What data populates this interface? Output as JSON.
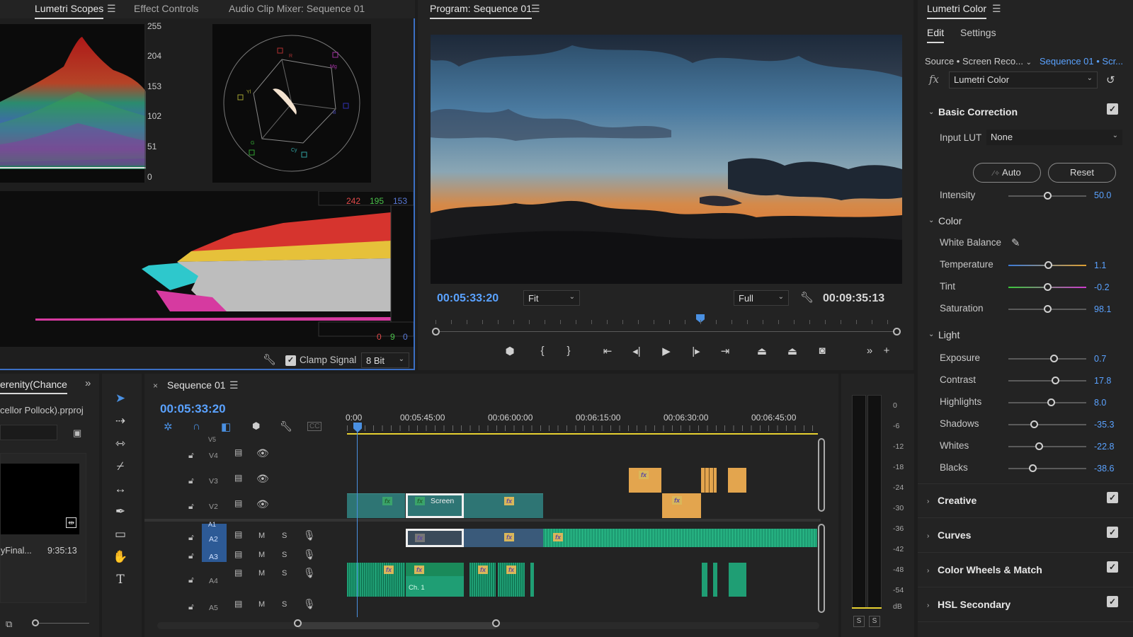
{
  "scopes_panel": {
    "tabs": [
      {
        "label": "Lumetri Scopes",
        "active": true
      },
      {
        "label": "Effect Controls",
        "active": false
      },
      {
        "label": "Audio Clip Mixer: Sequence 01",
        "active": false
      }
    ],
    "parade_scale": [
      "255",
      "204",
      "153",
      "102",
      "51",
      "0"
    ],
    "histogram_values": {
      "r": "242",
      "g": "195",
      "b": "153"
    },
    "histogram_values_low": {
      "r": "0",
      "g": "9",
      "b": "0"
    },
    "clamp_signal_label": "Clamp Signal",
    "clamp_signal_checked": true,
    "bit_depth": "8 Bit",
    "vectorscope_targets": [
      "R",
      "Mg",
      "B",
      "Cy",
      "G",
      "Yl"
    ]
  },
  "program_monitor": {
    "title": "Program: Sequence 01",
    "current_time": "00:05:33:20",
    "fit_option": "Fit",
    "resolution": "Full",
    "duration": "00:09:35:13",
    "playhead_fraction": 0.56
  },
  "lumetri_color": {
    "title": "Lumetri Color",
    "tabs": [
      {
        "label": "Edit",
        "active": true
      },
      {
        "label": "Settings",
        "active": false
      }
    ],
    "source_label": "Source • Screen Reco...",
    "sequence_label": "Sequence 01 • Scr...",
    "effect_name": "Lumetri Color",
    "fx_label": "fx",
    "basic_correction": "Basic Correction",
    "input_lut_label": "Input LUT",
    "input_lut_value": "None",
    "auto_label": "Auto",
    "reset_label": "Reset",
    "intensity": {
      "label": "Intensity",
      "value": "50.0",
      "fraction": 0.5
    },
    "color_section": "Color",
    "white_balance_label": "White Balance",
    "color_sliders": [
      {
        "label": "Temperature",
        "value": "1.1",
        "fraction": 0.52
      },
      {
        "label": "Tint",
        "value": "-0.2",
        "fraction": 0.5
      },
      {
        "label": "Saturation",
        "value": "98.1",
        "fraction": 0.5
      }
    ],
    "light_section": "Light",
    "light_sliders": [
      {
        "label": "Exposure",
        "value": "0.7",
        "fraction": 0.59
      },
      {
        "label": "Contrast",
        "value": "17.8",
        "fraction": 0.6
      },
      {
        "label": "Highlights",
        "value": "8.0",
        "fraction": 0.55
      },
      {
        "label": "Shadows",
        "value": "-35.3",
        "fraction": 0.33
      },
      {
        "label": "Whites",
        "value": "-22.8",
        "fraction": 0.39
      },
      {
        "label": "Blacks",
        "value": "-38.6",
        "fraction": 0.31
      }
    ],
    "collapsed_sections": [
      "Creative",
      "Curves",
      "Color Wheels & Match",
      "HSL Secondary"
    ]
  },
  "project_panel": {
    "tab_label": "erenity(Chance",
    "project_file": "cellor Pollock).prproj",
    "item_name": "yFinal...",
    "item_duration": "9:35:13"
  },
  "timeline": {
    "sequence_name": "Sequence 01",
    "current_time": "00:05:33:20",
    "ruler_labels": [
      "0:00",
      "00:05:45:00",
      "00:06:00:00",
      "00:06:15:00",
      "00:06:30:00",
      "00:06:45:00"
    ],
    "video_tracks": [
      "V5",
      "V4",
      "V3",
      "V2"
    ],
    "audio_tracks": [
      "A1",
      "A2",
      "A3",
      "A4",
      "A5"
    ],
    "mute_label": "M",
    "solo_label": "S",
    "clip_screen_label": "Screen",
    "clip_ch1_label": "Ch. 1",
    "fx_badge": "fx"
  },
  "audio_meter": {
    "db_scale": [
      "0",
      "-6",
      "-12",
      "-18",
      "-24",
      "-30",
      "-36",
      "-42",
      "-48",
      "-54",
      "dB"
    ],
    "solo_buttons": [
      "S",
      "S"
    ]
  },
  "colors": {
    "accent_blue": "#5aa2ff",
    "panel_bg": "#232323",
    "video_clip": "#2e7574",
    "orange_clip": "#e3a54e",
    "audio_clip": "#1f9e74"
  }
}
